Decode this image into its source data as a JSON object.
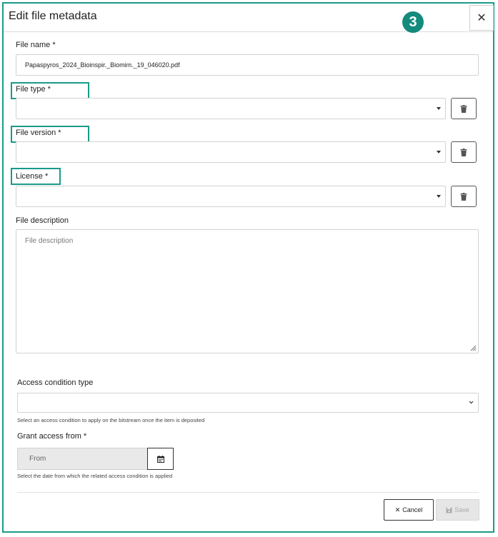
{
  "dialog": {
    "title": "Edit file metadata",
    "step_badge": "3",
    "close_symbol": "✕"
  },
  "file_name": {
    "label": "File name *",
    "value": "Papaspyros_2024_Bioinspir._Biomim._19_046020.pdf"
  },
  "file_type": {
    "label": "File type *",
    "value": ""
  },
  "file_version": {
    "label": "File version *",
    "value": ""
  },
  "license": {
    "label": "License *",
    "value": ""
  },
  "file_description": {
    "label": "File description",
    "placeholder": "File description"
  },
  "access_condition": {
    "label": "Access condition type",
    "value": "",
    "help": "Select an access condition to apply on the bitstream once the item is deposited"
  },
  "grant_access": {
    "label": "Grant access from *",
    "placeholder": "From",
    "help": "Select the date from which the related access condition is applied"
  },
  "footer": {
    "cancel_label": "Cancel",
    "cancel_symbol": "✕",
    "save_label": "Save"
  },
  "colors": {
    "highlight": "#1a9a8a",
    "badge": "#138a7c"
  },
  "icons": [
    "close-icon",
    "trash-icon",
    "caret-down-icon",
    "chevron-down-icon",
    "calendar-icon",
    "save-icon",
    "resize-handle-icon"
  ]
}
